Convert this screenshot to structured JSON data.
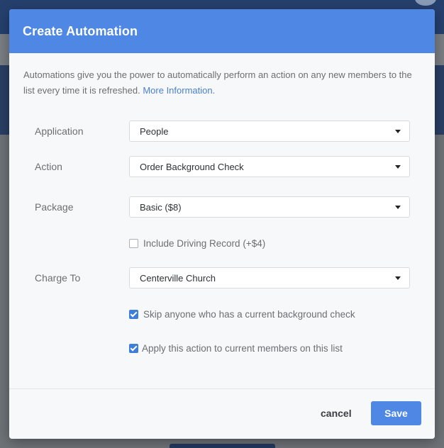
{
  "modal": {
    "title": "Create Automation",
    "intro_text": "Automations give you the power to automatically perform an action on any new members to the list every time it is refreshed.",
    "more_info_link": "More Information."
  },
  "form": {
    "application": {
      "label": "Application",
      "value": "People"
    },
    "action": {
      "label": "Action",
      "value": "Order Background Check"
    },
    "package": {
      "label": "Package",
      "value": "Basic ($8)"
    },
    "include_driving_record": {
      "label": "Include Driving Record (+$4)",
      "checked": false
    },
    "charge_to": {
      "label": "Charge To",
      "value": "Centerville Church"
    },
    "skip_current": {
      "label": "Skip anyone who has a current background check",
      "checked": true
    },
    "apply_current": {
      "label": "Apply this action to current members on this list",
      "checked": true
    }
  },
  "footer": {
    "cancel_label": "cancel",
    "save_label": "Save"
  },
  "colors": {
    "header": "#4e87e4",
    "link": "#4a7fd4",
    "checkbox_checked": "#3f7ddb"
  },
  "icons": {
    "select_caret": "caret-down-icon",
    "checkmark": "checkmark-icon"
  }
}
